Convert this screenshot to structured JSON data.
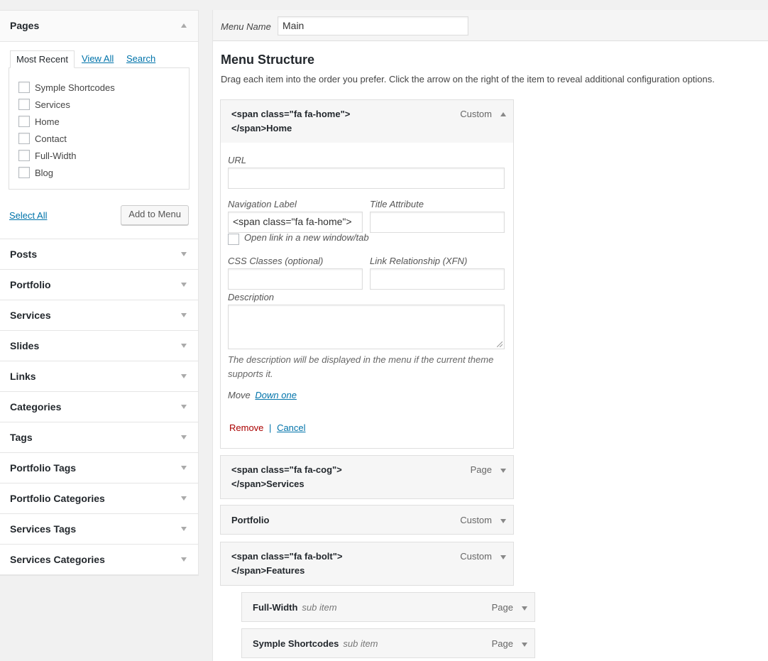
{
  "sidebar": {
    "pages": {
      "title": "Pages",
      "tabs": [
        "Most Recent",
        "View All",
        "Search"
      ],
      "items": [
        "Symple Shortcodes",
        "Services",
        "Home",
        "Contact",
        "Full-Width",
        "Blog"
      ],
      "select_all": "Select All",
      "add_button": "Add to Menu"
    },
    "sections": [
      "Posts",
      "Portfolio",
      "Services",
      "Slides",
      "Links",
      "Categories",
      "Tags",
      "Portfolio Tags",
      "Portfolio Categories",
      "Services Tags",
      "Services Categories"
    ]
  },
  "menu": {
    "name_label": "Menu Name",
    "name_value": "Main",
    "structure_title": "Menu Structure",
    "structure_desc": "Drag each item into the order you prefer. Click the arrow on the right of the item to reveal additional configuration options.",
    "open_item": {
      "title_line1": "<span class=\"fa fa-home\">",
      "title_line2": "</span>Home",
      "type": "Custom",
      "url_label": "URL",
      "url_value": "",
      "nav_label": "Navigation Label",
      "nav_value": "<span class=\"fa fa-home\">",
      "title_attr_label": "Title Attribute",
      "new_window_label": "Open link in a new window/tab",
      "css_label": "CSS Classes (optional)",
      "xfn_label": "Link Relationship (XFN)",
      "desc_label": "Description",
      "help_text": "The description will be displayed in the menu if the current theme supports it.",
      "move_label": "Move",
      "move_link": "Down one",
      "remove": "Remove",
      "separator": "|",
      "cancel": "Cancel"
    },
    "items": [
      {
        "line1": "<span class=\"fa fa-cog\">",
        "line2": "</span>Services",
        "type": "Page"
      },
      {
        "line1": "Portfolio",
        "type": "Custom"
      },
      {
        "line1": "<span class=\"fa fa-bolt\">",
        "line2": "</span>Features",
        "type": "Custom"
      },
      {
        "line1": "Full-Width",
        "sub": "sub item",
        "type": "Page"
      },
      {
        "line1": "Symple Shortcodes",
        "sub": "sub item",
        "type": "Page"
      }
    ]
  }
}
